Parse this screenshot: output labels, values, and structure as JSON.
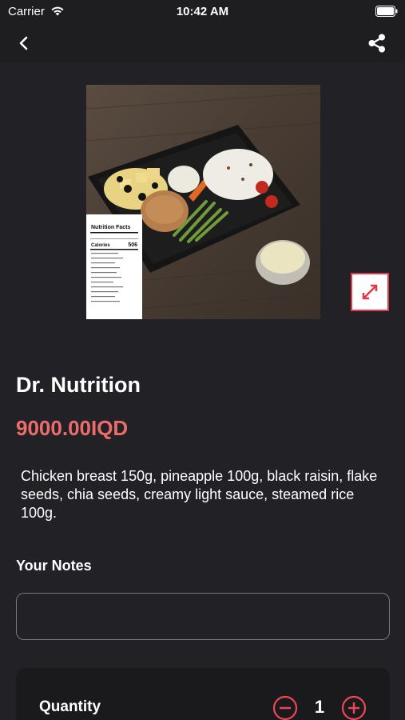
{
  "status_bar": {
    "carrier": "Carrier",
    "time": "10:42 AM"
  },
  "nav": {
    "back_icon": "chevron-left-icon",
    "share_icon": "share-icon"
  },
  "product": {
    "title": "Dr. Nutrition",
    "price": "9000.00IQD",
    "description": "Chicken breast 150g, pineapple 100g, black raisin, flake seeds, chia seeds, creamy light sauce, steamed rice 100g.",
    "nutrition_label": {
      "heading": "Nutrition Facts",
      "calories_label": "Calories",
      "calories_value": "506"
    }
  },
  "notes": {
    "label": "Your Notes",
    "value": "",
    "placeholder": ""
  },
  "quantity": {
    "label": "Quantity",
    "value": "1"
  },
  "colors": {
    "background": "#222226",
    "price": "#ec6b6b",
    "accent": "#e03a4d"
  }
}
